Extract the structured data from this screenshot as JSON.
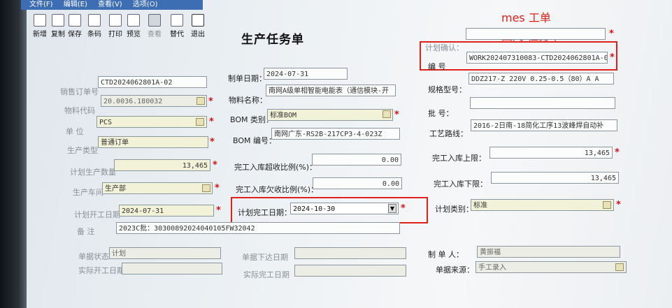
{
  "menu": {
    "file": "文件(F)",
    "edit": "编辑(E)",
    "view": "查看(V)",
    "options": "选项(O)"
  },
  "toolbar": [
    {
      "id": "new",
      "label": "新增"
    },
    {
      "id": "copy",
      "label": "复制"
    },
    {
      "id": "save",
      "label": "保存"
    },
    {
      "id": "barcode",
      "label": "条码"
    },
    {
      "id": "print",
      "label": "打印"
    },
    {
      "id": "preview",
      "label": "预览"
    },
    {
      "id": "view",
      "label": "查看"
    },
    {
      "id": "replace",
      "label": "替代"
    },
    {
      "id": "exit",
      "label": "退出"
    }
  ],
  "form_title": "生产任务单",
  "annotation": {
    "line1": "mes 工单",
    "line2": "国网 任务单"
  },
  "plan_confirm": {
    "label": "计划确认："
  },
  "code": {
    "label": "编    号",
    "value": "WORK202407310083-CTD2024062801A-0"
  },
  "sales_order": {
    "label": "销售订单号",
    "value": "CTD2024062801A-02"
  },
  "make_date": {
    "label": "制单日期：",
    "value": "2024-07-31"
  },
  "material_code": {
    "label": "物料代码",
    "value": "20.0036.180032"
  },
  "material_name": {
    "label": "物料名称：",
    "value": "南网A级单相智能电能表（通信模块-开"
  },
  "spec": {
    "label": "规格型号：",
    "value": "DDZ217-Z  220V  0.25-0.5（80）A  A"
  },
  "unit": {
    "label": "单    位",
    "value": "PCS"
  },
  "bom_type": {
    "label": "BOM 类别：",
    "value": "标准BOM"
  },
  "batch": {
    "label": "批    号：",
    "value": ""
  },
  "prod_type": {
    "label": "生产类型",
    "value": "普通订单"
  },
  "bom_no": {
    "label": "BOM 编号：",
    "value": "南网广东-RS2B-217CP3-4-023Z"
  },
  "route": {
    "label": "工艺路线：",
    "value": "2016-2日南-18简化工序13波峰焊自动补"
  },
  "plan_qty": {
    "label": "计划生产数量",
    "value": "13,465"
  },
  "over_ratio": {
    "label": "完工入库超收比例(%)：",
    "value": "0.00"
  },
  "upper_limit": {
    "label": "完工入库上限：",
    "value": "13,465"
  },
  "workshop": {
    "label": "生产车间",
    "value": "生产部"
  },
  "short_ratio": {
    "label": "完工入库欠收比例(%)：",
    "value": "0.00"
  },
  "lower_limit": {
    "label": "完工入库下限：",
    "value": "13,465"
  },
  "plan_start": {
    "label": "计划开工日期",
    "value": "2024-07-31"
  },
  "plan_finish": {
    "label": "计划完工日期：",
    "value": "2024-10-30"
  },
  "plan_category": {
    "label": "计划类别：",
    "value": "标准"
  },
  "remark": {
    "label": "备    注",
    "value": "2023C批：30300892024040105FW32042"
  },
  "doc_status": {
    "label": "单据状态",
    "value": "计划"
  },
  "issue_date": {
    "label": "单据下达日期",
    "value": ""
  },
  "maker": {
    "label": "制  单  人：",
    "value": "黄振福"
  },
  "actual_start": {
    "label": "实际开工日期",
    "value": ""
  },
  "actual_finish": {
    "label": "实际完工日期",
    "value": ""
  },
  "source": {
    "label": "单据来源：",
    "value": "手工录入"
  }
}
